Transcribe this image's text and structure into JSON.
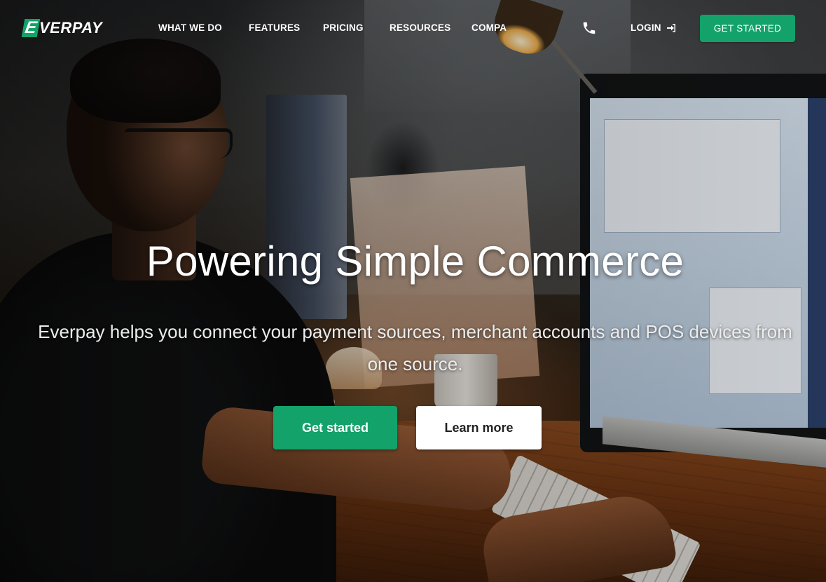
{
  "brand": {
    "logo_mark": "E",
    "logo_text": "VERPAY",
    "accent_color": "#13a26a"
  },
  "nav": {
    "items": [
      {
        "label": "WHAT WE DO"
      },
      {
        "label": "FEATURES"
      },
      {
        "label": "PRICING"
      },
      {
        "label": "RESOURCES"
      },
      {
        "label": "COMPA"
      }
    ],
    "phone_icon": "phone-icon",
    "login_label": "LOGIN",
    "login_icon": "sign-in-icon",
    "cta_label": "GET STARTED"
  },
  "hero": {
    "title": "Powering Simple Commerce",
    "subtitle": "Everpay helps you connect your payment sources, merchant accounts and POS devices from one source.",
    "primary_button": "Get started",
    "secondary_button": "Learn more"
  }
}
